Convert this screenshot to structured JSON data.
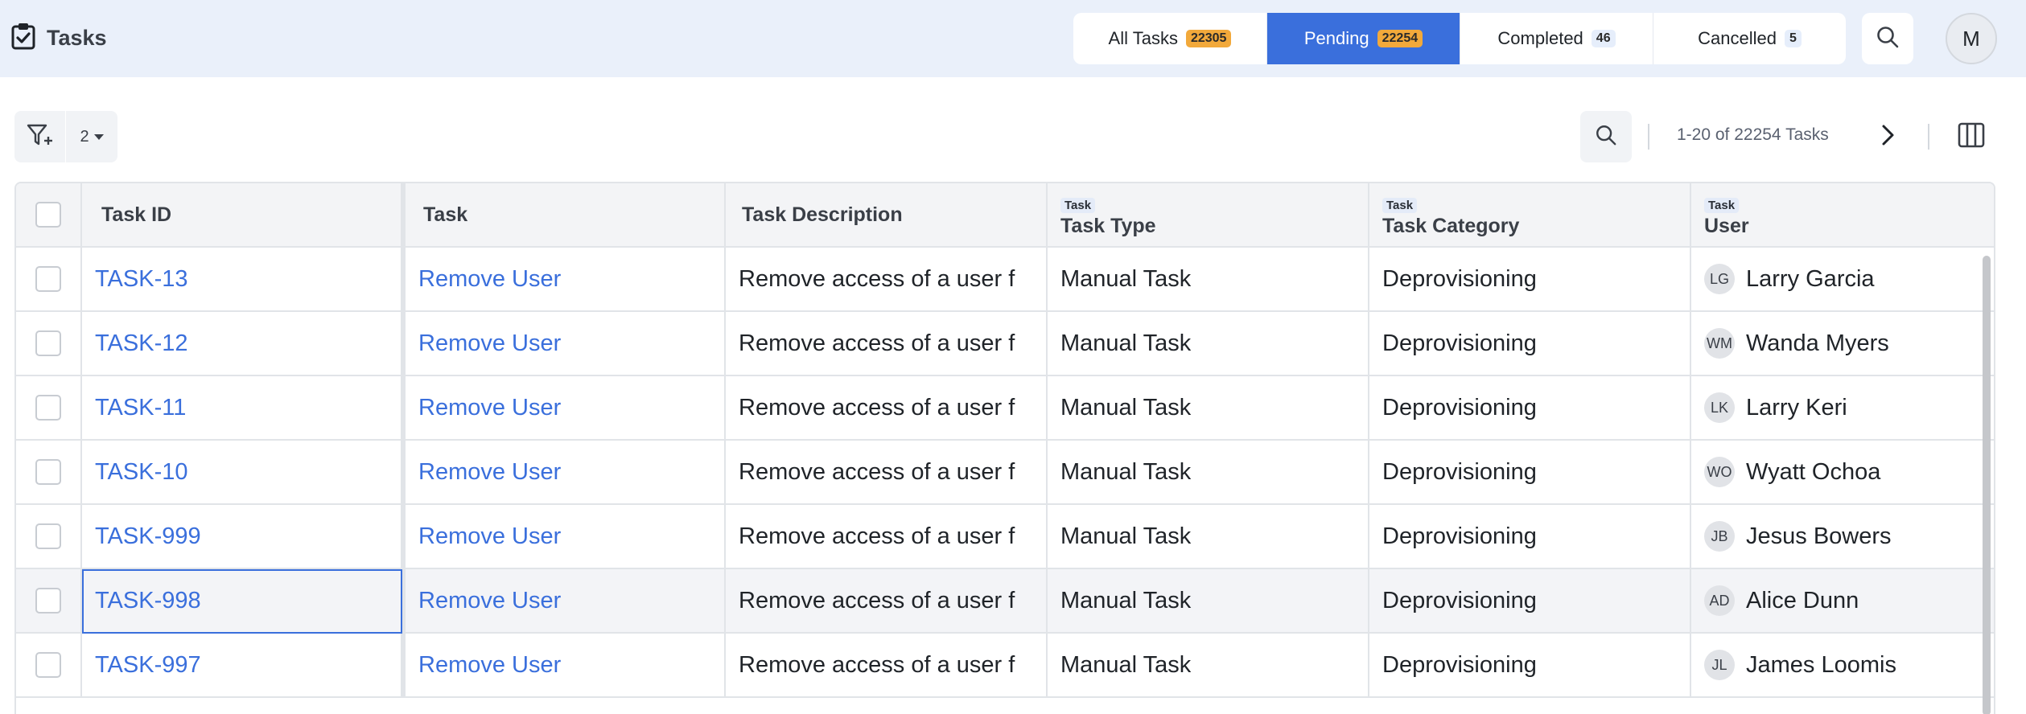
{
  "app": {
    "title": "Tasks",
    "icon": "clipboard-check-icon"
  },
  "tabs": [
    {
      "label": "All Tasks",
      "count": "22305",
      "active": false
    },
    {
      "label": "Pending",
      "count": "22254",
      "active": true
    },
    {
      "label": "Completed",
      "count": "46",
      "active": false
    },
    {
      "label": "Cancelled",
      "count": "5",
      "active": false
    }
  ],
  "header": {
    "avatar_initial": "M",
    "search_icon": "search-icon"
  },
  "toolbar": {
    "filter_icon": "filter-add-icon",
    "filter_count": "2",
    "pagination": "1-20 of 22254 Tasks",
    "next_icon": "chevron-right-icon",
    "columns_icon": "columns-icon"
  },
  "table": {
    "columns": {
      "task_id": "Task ID",
      "task": "Task",
      "task_description": "Task Description",
      "task_type": {
        "tag": "Task",
        "label": "Task Type"
      },
      "task_category": {
        "tag": "Task",
        "label": "Task Category"
      },
      "user": {
        "tag": "Task",
        "label": "User"
      }
    },
    "rows": [
      {
        "id": "TASK-13",
        "task": "Remove User",
        "description": "Remove access of a user f",
        "type": "Manual Task",
        "category": "Deprovisioning",
        "initials": "LG",
        "user": "Larry Garcia"
      },
      {
        "id": "TASK-12",
        "task": "Remove User",
        "description": "Remove access of a user f",
        "type": "Manual Task",
        "category": "Deprovisioning",
        "initials": "WM",
        "user": "Wanda Myers"
      },
      {
        "id": "TASK-11",
        "task": "Remove User",
        "description": "Remove access of a user f",
        "type": "Manual Task",
        "category": "Deprovisioning",
        "initials": "LK",
        "user": "Larry Keri"
      },
      {
        "id": "TASK-10",
        "task": "Remove User",
        "description": "Remove access of a user f",
        "type": "Manual Task",
        "category": "Deprovisioning",
        "initials": "WO",
        "user": "Wyatt Ochoa"
      },
      {
        "id": "TASK-999",
        "task": "Remove User",
        "description": "Remove access of a user f",
        "type": "Manual Task",
        "category": "Deprovisioning",
        "initials": "JB",
        "user": "Jesus Bowers"
      },
      {
        "id": "TASK-998",
        "task": "Remove User",
        "description": "Remove access of a user f",
        "type": "Manual Task",
        "category": "Deprovisioning",
        "initials": "AD",
        "user": "Alice Dunn"
      },
      {
        "id": "TASK-997",
        "task": "Remove User",
        "description": "Remove access of a user f",
        "type": "Manual Task",
        "category": "Deprovisioning",
        "initials": "JL",
        "user": "James Loomis"
      }
    ]
  },
  "colors": {
    "accent": "#3a6fdc",
    "badge_orange": "#f2a93b",
    "header_bg": "#eaf0fa"
  }
}
